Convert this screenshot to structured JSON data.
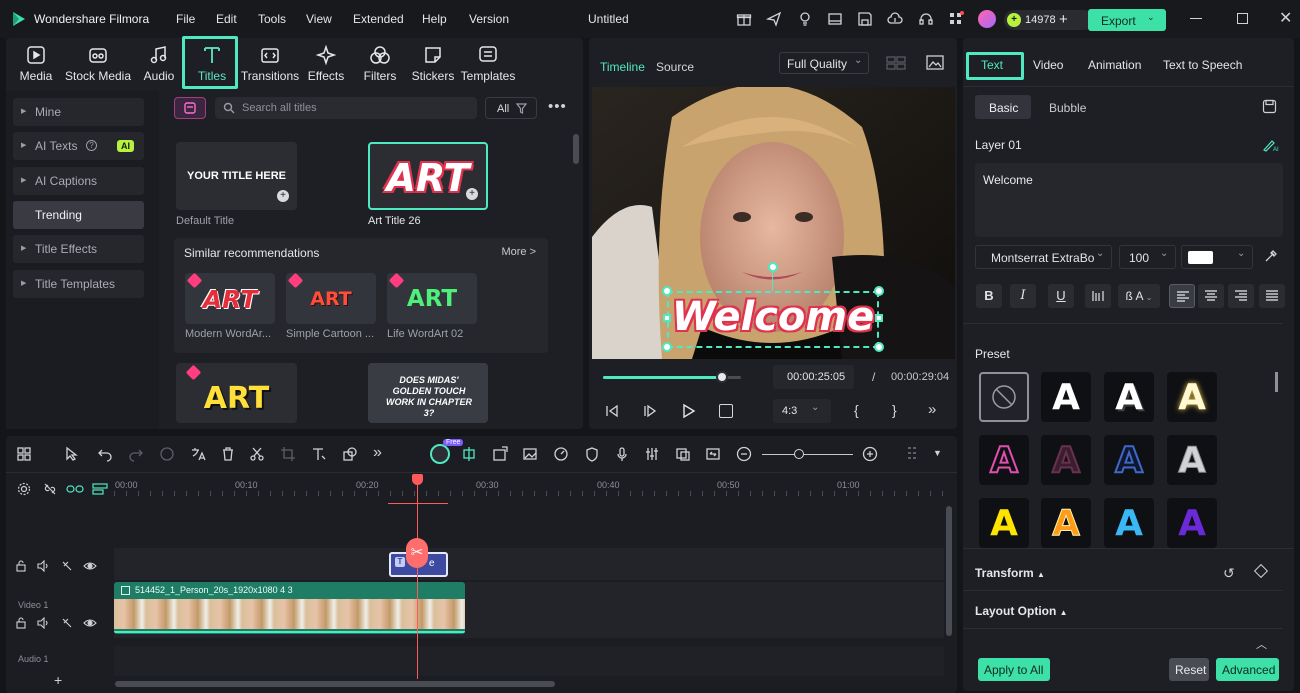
{
  "app": {
    "title": "Wondershare Filmora",
    "document": "Untitled"
  },
  "menu": [
    "File",
    "Edit",
    "Tools",
    "View",
    "Extended",
    "Help",
    "Version"
  ],
  "credits": "14978",
  "export_label": "Export",
  "nav_tabs": [
    {
      "label": "Media",
      "icon": "media-icon"
    },
    {
      "label": "Stock Media",
      "icon": "stock-media-icon"
    },
    {
      "label": "Audio",
      "icon": "music-note-icon"
    },
    {
      "label": "Titles",
      "icon": "text-t-icon",
      "active": true
    },
    {
      "label": "Transitions",
      "icon": "transitions-icon"
    },
    {
      "label": "Effects",
      "icon": "sparkle-icon"
    },
    {
      "label": "Filters",
      "icon": "filters-icon"
    },
    {
      "label": "Stickers",
      "icon": "sticker-icon"
    },
    {
      "label": "Templates",
      "icon": "templates-icon"
    }
  ],
  "sidebar": [
    "Mine",
    "AI Texts",
    "AI Captions",
    "Trending",
    "Title Effects",
    "Title Templates"
  ],
  "ai_badge": "AI",
  "search": {
    "placeholder": "Search all titles",
    "filter_label": "All"
  },
  "titles": {
    "default": {
      "thumb": "YOUR TITLE HERE",
      "label": "Default Title"
    },
    "art26": {
      "thumb": "ART",
      "label": "Art Title 26"
    }
  },
  "similar": {
    "heading": "Similar recommendations",
    "more": "More >",
    "items": [
      {
        "thumb": "ART",
        "label": "Modern WordAr..."
      },
      {
        "thumb": "ART",
        "label": "Simple Cartoon ..."
      },
      {
        "thumb": "ART",
        "label": "Life WordArt 02"
      }
    ]
  },
  "bottom_cards": {
    "art": "ART",
    "comic": "DOES MIDAS' GOLDEN TOUCH WORK IN CHAPTER 3?"
  },
  "preview": {
    "tabs": [
      "Timeline",
      "Source"
    ],
    "quality": "Full Quality",
    "overlay_text": "Welcome",
    "time_current": "00:00:25:05",
    "time_sep": "/",
    "time_total": "00:00:29:04",
    "aspect": "4:3",
    "progress": 0.86
  },
  "timeline": {
    "ruler": [
      "00:00",
      "00:10",
      "00:20",
      "00:30",
      "00:40",
      "00:50",
      "01:00"
    ],
    "free_badge": "Free",
    "clip_name": "514452_1_Person_20s_1920x1080 4 3",
    "title_clip": "e",
    "tracks": [
      "Video 1",
      "Audio 1"
    ]
  },
  "right": {
    "tabs": [
      "Text",
      "Video",
      "Animation",
      "Text to Speech"
    ],
    "subtabs": [
      "Basic",
      "Bubble"
    ],
    "layer": "Layer 01",
    "text_value": "Welcome",
    "font": "Montserrat ExtraBo",
    "size": "100",
    "case_label": "ß A",
    "preset_label": "Preset",
    "sections": [
      "Transform",
      "Layout Option"
    ],
    "apply_all": "Apply to All",
    "reset": "Reset",
    "advanced": "Advanced"
  },
  "colors": {
    "accent": "#3de0a6",
    "highlight": "#4ee9c1",
    "bg": "#141519",
    "panel": "#1e1f24",
    "playhead": "#ff5a5a"
  }
}
